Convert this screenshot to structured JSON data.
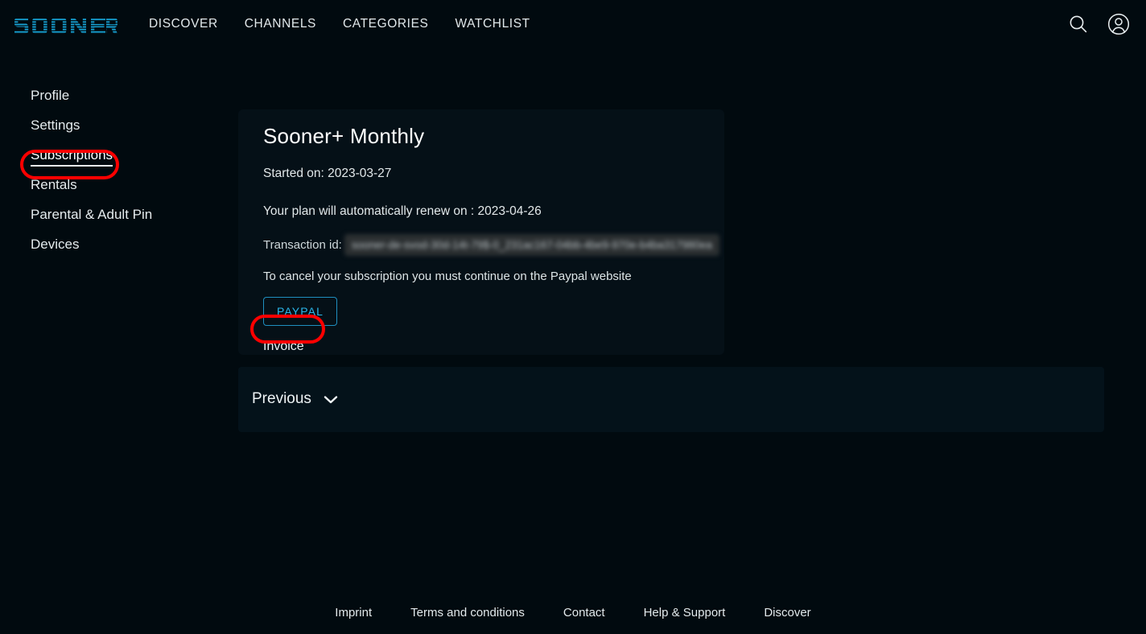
{
  "brand": {
    "name": "SOONER",
    "logo_color": "#16a3d6"
  },
  "navbar": {
    "links": [
      {
        "label": "DISCOVER"
      },
      {
        "label": "CHANNELS"
      },
      {
        "label": "CATEGORIES"
      },
      {
        "label": "WATCHLIST"
      }
    ],
    "actions": [
      {
        "icon": "search-icon"
      },
      {
        "icon": "account-icon"
      }
    ]
  },
  "sidebar": {
    "items": [
      {
        "label": "Profile",
        "active": false
      },
      {
        "label": "Settings",
        "active": false
      },
      {
        "label": "Subscriptions",
        "active": true
      },
      {
        "label": "Rentals",
        "active": false
      },
      {
        "label": "Parental & Adult Pin",
        "active": false
      },
      {
        "label": "Devices",
        "active": false
      }
    ]
  },
  "subscription_card": {
    "plan_title": "Sooner+ Monthly",
    "started_label": "Started on: 2023-03-27",
    "renew_label": "Your plan will automatically renew on : 2023-04-26",
    "transaction_label": "Transaction id:",
    "transaction_value": "sooner-de-svod-30d-14t-79$-0_231ac167-04bb-4be9-970e-b4ba317980ea",
    "cancel_note": "To cancel your subscription you must continue on the Paypal website",
    "paypal_button": "PAYPAL",
    "invoice_button": "Invoice"
  },
  "previous_section": {
    "label": "Previous",
    "chevron": "chevron-down-icon"
  },
  "footer": {
    "links": [
      {
        "label": "Imprint"
      },
      {
        "label": "Terms and conditions"
      },
      {
        "label": "Contact"
      },
      {
        "label": "Help & Support"
      },
      {
        "label": "Discover"
      }
    ]
  },
  "annotations": {
    "color": "#ff0000",
    "targets": [
      "Subscriptions",
      "Invoice"
    ]
  },
  "colors": {
    "page_background": "#010a0f",
    "card_background": "#051017",
    "panel_background": "#04121a",
    "accent_cyan": "#2bb6ea",
    "text_primary": "#e9eef0"
  }
}
